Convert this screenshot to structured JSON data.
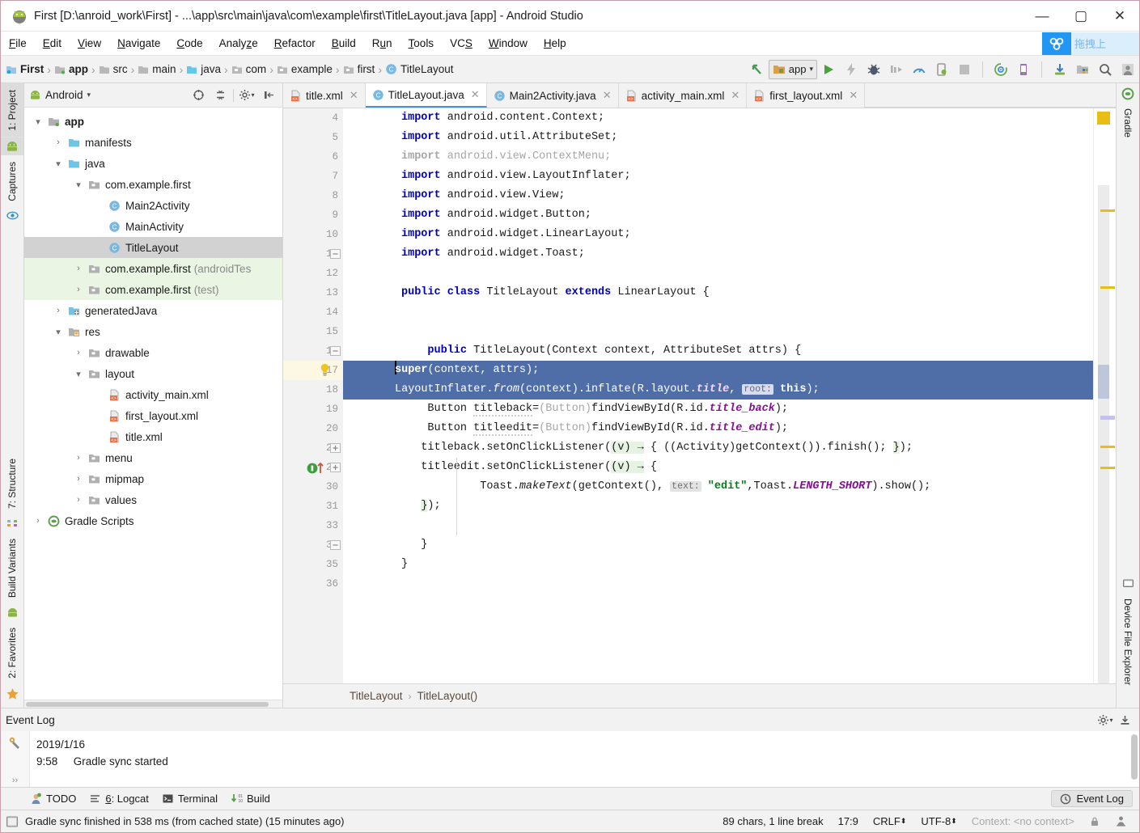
{
  "window": {
    "title": "First [D:\\anroid_work\\First] - ...\\app\\src\\main\\java\\com\\example\\first\\TitleLayout.java [app] - Android Studio",
    "minimize": "—",
    "maximize": "▢",
    "close": "✕"
  },
  "menu": {
    "items": [
      "File",
      "Edit",
      "View",
      "Navigate",
      "Code",
      "Analyze",
      "Refactor",
      "Build",
      "Run",
      "Tools",
      "VCS",
      "Window",
      "Help"
    ],
    "plugin_text": "拖拽上"
  },
  "toolbar": {
    "breadcrumb": [
      {
        "label": "First",
        "icon": "module-icon",
        "bold": true
      },
      {
        "label": "app",
        "icon": "module-icon",
        "bold": true
      },
      {
        "label": "src",
        "icon": "folder-icon",
        "bold": false
      },
      {
        "label": "main",
        "icon": "folder-icon",
        "bold": false
      },
      {
        "label": "java",
        "icon": "folder-java-icon",
        "bold": false
      },
      {
        "label": "com",
        "icon": "package-icon",
        "bold": false
      },
      {
        "label": "example",
        "icon": "package-icon",
        "bold": false
      },
      {
        "label": "first",
        "icon": "package-icon",
        "bold": false
      },
      {
        "label": "TitleLayout",
        "icon": "class-icon",
        "bold": false
      }
    ],
    "separator": "›",
    "run_config": "app",
    "icons": [
      "back-arrow-icon",
      "run-icon",
      "apply-changes-icon",
      "debug-icon",
      "profile-run-icon",
      "profiler-icon",
      "device-install-icon",
      "stop-icon",
      "sdk-sync-icon",
      "avd-manager-icon",
      "sdk-manager-icon",
      "project-structure-icon",
      "search-icon",
      "user-icon"
    ]
  },
  "project_panel": {
    "title": "Android",
    "dropdown_caret": "▾",
    "header_icons": [
      "target-icon",
      "collapse-all-icon",
      "settings-gear-icon",
      "hide-panel-icon"
    ],
    "tree": [
      {
        "depth": 0,
        "arrow": "▾",
        "icon": "module-icon",
        "label": "app",
        "bold": true,
        "suffix": "",
        "state": "normal"
      },
      {
        "depth": 1,
        "arrow": "›",
        "icon": "folder-icon",
        "label": "manifests",
        "bold": false,
        "suffix": "",
        "state": "normal"
      },
      {
        "depth": 1,
        "arrow": "▾",
        "icon": "folder-icon",
        "label": "java",
        "bold": false,
        "suffix": "",
        "state": "normal"
      },
      {
        "depth": 2,
        "arrow": "▾",
        "icon": "package-icon",
        "label": "com.example.first",
        "bold": false,
        "suffix": "",
        "state": "normal"
      },
      {
        "depth": 3,
        "arrow": "",
        "icon": "class-icon",
        "label": "Main2Activity",
        "bold": false,
        "suffix": "",
        "state": "normal"
      },
      {
        "depth": 3,
        "arrow": "",
        "icon": "class-icon",
        "label": "MainActivity",
        "bold": false,
        "suffix": "",
        "state": "normal"
      },
      {
        "depth": 3,
        "arrow": "",
        "icon": "class-icon",
        "label": "TitleLayout",
        "bold": false,
        "suffix": "",
        "state": "selected"
      },
      {
        "depth": 2,
        "arrow": "›",
        "icon": "package-icon",
        "label": "com.example.first",
        "bold": false,
        "suffix": "(androidTes",
        "state": "green"
      },
      {
        "depth": 2,
        "arrow": "›",
        "icon": "package-icon",
        "label": "com.example.first",
        "bold": false,
        "suffix": "(test)",
        "state": "green"
      },
      {
        "depth": 1,
        "arrow": "›",
        "icon": "generated-folder-icon",
        "label": "generatedJava",
        "bold": false,
        "suffix": "",
        "state": "normal"
      },
      {
        "depth": 1,
        "arrow": "▾",
        "icon": "res-folder-icon",
        "label": "res",
        "bold": false,
        "suffix": "",
        "state": "normal"
      },
      {
        "depth": 2,
        "arrow": "›",
        "icon": "package-icon",
        "label": "drawable",
        "bold": false,
        "suffix": "",
        "state": "normal"
      },
      {
        "depth": 2,
        "arrow": "▾",
        "icon": "package-icon",
        "label": "layout",
        "bold": false,
        "suffix": "",
        "state": "normal"
      },
      {
        "depth": 3,
        "arrow": "",
        "icon": "xml-file-icon",
        "label": "activity_main.xml",
        "bold": false,
        "suffix": "",
        "state": "normal"
      },
      {
        "depth": 3,
        "arrow": "",
        "icon": "xml-file-icon",
        "label": "first_layout.xml",
        "bold": false,
        "suffix": "",
        "state": "normal"
      },
      {
        "depth": 3,
        "arrow": "",
        "icon": "xml-file-icon",
        "label": "title.xml",
        "bold": false,
        "suffix": "",
        "state": "normal"
      },
      {
        "depth": 2,
        "arrow": "›",
        "icon": "package-icon",
        "label": "menu",
        "bold": false,
        "suffix": "",
        "state": "normal"
      },
      {
        "depth": 2,
        "arrow": "›",
        "icon": "package-icon",
        "label": "mipmap",
        "bold": false,
        "suffix": "",
        "state": "normal"
      },
      {
        "depth": 2,
        "arrow": "›",
        "icon": "package-icon",
        "label": "values",
        "bold": false,
        "suffix": "",
        "state": "normal"
      },
      {
        "depth": 0,
        "arrow": "›",
        "icon": "gradle-icon",
        "label": "Gradle Scripts",
        "bold": false,
        "suffix": "",
        "state": "normal"
      }
    ]
  },
  "left_strip": [
    {
      "label": "1: Project",
      "icon": "android-icon",
      "selected": true
    },
    {
      "label": "Captures",
      "icon": "captures-icon",
      "selected": false
    },
    {
      "label": "7: Structure",
      "icon": "structure-icon",
      "selected": false
    },
    {
      "label": "Build Variants",
      "icon": "android-green-icon",
      "selected": false
    },
    {
      "label": "2: Favorites",
      "icon": "star-icon",
      "selected": false
    }
  ],
  "right_strip": [
    {
      "label": "Gradle",
      "icon": "gradle-icon",
      "selected": false
    },
    {
      "label": "Device File Explorer",
      "icon": "device-icon",
      "selected": false
    }
  ],
  "editor_tabs": [
    {
      "label": "title.xml",
      "icon": "xml-file-icon",
      "active": false,
      "close": "✕"
    },
    {
      "label": "TitleLayout.java",
      "icon": "class-icon",
      "active": true,
      "close": "✕"
    },
    {
      "label": "Main2Activity.java",
      "icon": "class-icon",
      "active": false,
      "close": "✕"
    },
    {
      "label": "activity_main.xml",
      "icon": "xml-file-icon",
      "active": false,
      "close": "✕"
    },
    {
      "label": "first_layout.xml",
      "icon": "xml-file-icon",
      "active": false,
      "close": "✕"
    }
  ],
  "code": {
    "line_numbers": [
      "4",
      "5",
      "6",
      "7",
      "8",
      "9",
      "10",
      "11",
      "12",
      "13",
      "14",
      "15",
      "16",
      "17",
      "18",
      "19",
      "20",
      "21",
      "27",
      "30",
      "31",
      "33",
      "34",
      "35",
      "36"
    ],
    "lines": [
      "import android.content.Context;",
      "import android.util.AttributeSet;",
      "import android.view.ContextMenu;",
      "import android.view.LayoutInflater;",
      "import android.view.View;",
      "import android.widget.Button;",
      "import android.widget.LinearLayout;",
      "import android.widget.Toast;",
      "",
      "public class TitleLayout extends LinearLayout {",
      "",
      "",
      "    public TitleLayout(Context context, AttributeSet attrs) {",
      "        super(context, attrs);",
      "        LayoutInflater.from(context).inflate(R.layout.title, root: this);",
      "        Button titleback=(Button)findViewById(R.id.title_back);",
      "        Button titleedit=(Button)findViewById(R.id.title_edit);",
      "        titleback.setOnClickListener((v) → { ((Activity)getContext()).finish(); });",
      "        titleedit.setOnClickListener((v) → {",
      "                Toast.makeText(getContext(), text: \"edit\",Toast.LENGTH_SHORT).show();",
      "        });",
      "",
      "    }",
      "}",
      ""
    ],
    "cursor_line": "17",
    "intention_bulb": "lightbulb-icon"
  },
  "editor_breadcrumb": {
    "items": [
      "TitleLayout",
      "TitleLayout()"
    ],
    "separator": "›"
  },
  "event_log": {
    "title": "Event Log",
    "header_icons": [
      "settings-gear-icon",
      "hide-panel-icon"
    ],
    "entries": [
      {
        "date": "2019/1/16",
        "time": "9:58",
        "message": "Gradle sync started"
      }
    ],
    "expand": "››"
  },
  "bottom_tabs": [
    {
      "label": "TODO",
      "icon": "todo-icon"
    },
    {
      "label": "6: Logcat",
      "icon": "logcat-icon",
      "mnemonic": "6"
    },
    {
      "label": "Terminal",
      "icon": "terminal-icon"
    },
    {
      "label": "Build",
      "icon": "build-icon"
    }
  ],
  "event_log_button": {
    "label": "Event Log",
    "icon": "event-log-icon"
  },
  "status_bar": {
    "message": "Gradle sync finished in 538 ms (from cached state) (15 minutes ago)",
    "chars": "89 chars, 1 line break",
    "position": "17:9",
    "line_separator": "CRLF",
    "encoding": "UTF-8",
    "context": "Context: <no context>",
    "icons": [
      "lock-icon",
      "inspection-icon"
    ]
  },
  "colors": {
    "accent_blue": "#4a90d9",
    "selection_blue": "#4f6ea8",
    "keyword": "#0000c0",
    "string_green": "#067d17",
    "constant_purple": "#871094",
    "cursor_line": "#fcf8e4",
    "tree_green": "#eaf5e4"
  }
}
